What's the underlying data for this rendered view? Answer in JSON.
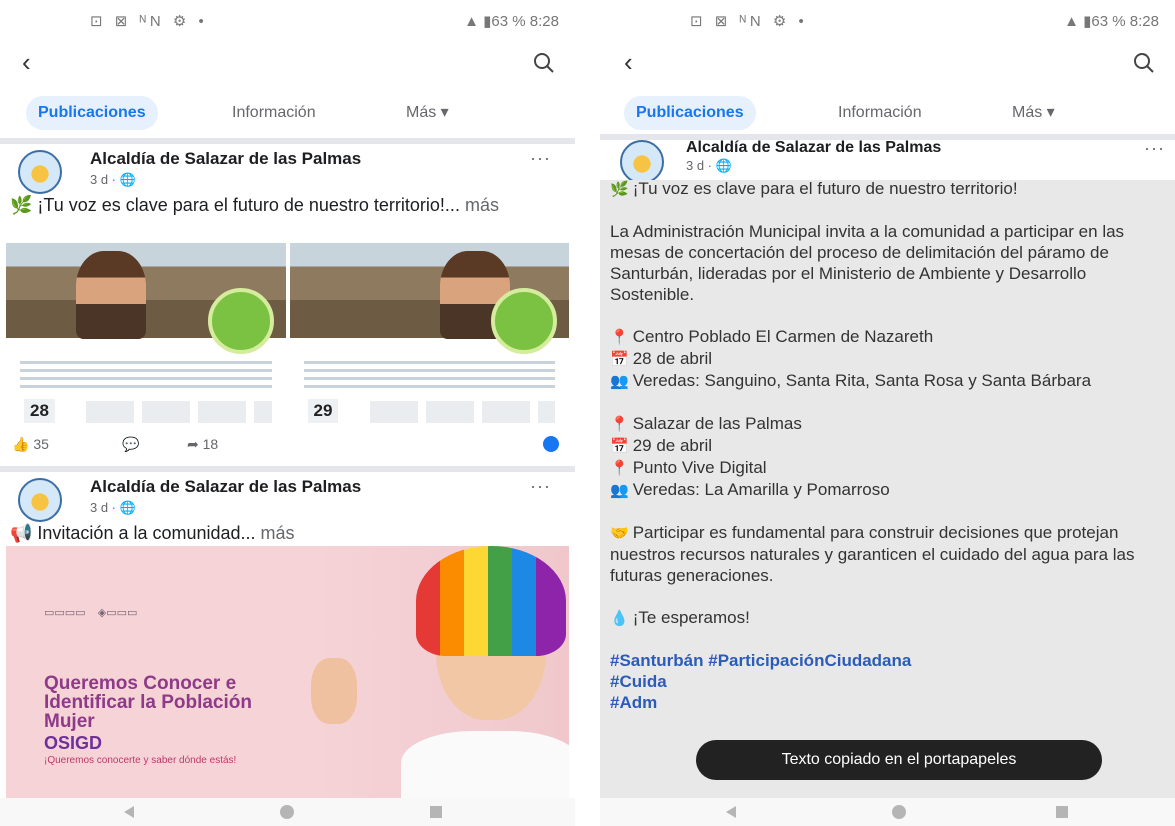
{
  "status": {
    "left_icons": "⊡ ⊠ ᴺN ⚙ •",
    "battery": "▲ ▮63 %",
    "time": "8:28"
  },
  "tabs": [
    {
      "label": "Publicaciones"
    },
    {
      "label": "Información"
    },
    {
      "label": "Más ▾"
    }
  ],
  "page_name": "Alcaldía de Salazar de las Palmas",
  "post_time": "3 d · 🌐",
  "posts": [
    {
      "text": "🌿 ¡Tu voz es clave para el futuro de nuestro territorio!...",
      "more": " más",
      "images": [
        {
          "date": "28"
        },
        {
          "date": "29"
        }
      ],
      "likes": "35",
      "shares": "18"
    },
    {
      "text": "📢 Invitación a la comunidad...",
      "more": " más",
      "banner": {
        "title": "Queremos Conocer e Identificar la Población Mujer",
        "lgbt": "OSIGD",
        "subtitle": "¡Queremos conocerte y saber dónde estás!"
      }
    }
  ],
  "detail": {
    "intro": "¡Tu voz es clave para el futuro de nuestro territorio!",
    "invite": "La Administración Municipal invita a la comunidad a participar en las mesas de concertación del proceso de delimitación del páramo de Santurbán, lideradas por el Ministerio de Ambiente y Desarrollo Sostenible.",
    "place1": "Centro Poblado El Carmen de Nazareth",
    "date1": "28 de abril",
    "veredas1": "Veredas: Sanguino, Santa Rita, Santa Rosa y Santa Bárbara",
    "place2": "Salazar de las Palmas",
    "date2": "29 de abril",
    "venue2": "Punto Vive Digital",
    "veredas2": "Veredas: La Amarilla y Pomarroso",
    "participate": "Participar es fundamental para construir decisiones que protejan nuestros recursos naturales y garanticen el cuidado del agua para las futuras generaciones.",
    "closing": "¡Te esperamos!",
    "hashtags1": "#Santurbán #ParticipaciónCiudadana",
    "hashtags2": "#Cuida",
    "hashtags3": "#Adm"
  },
  "toast": "Texto copiado en el portapapeles"
}
